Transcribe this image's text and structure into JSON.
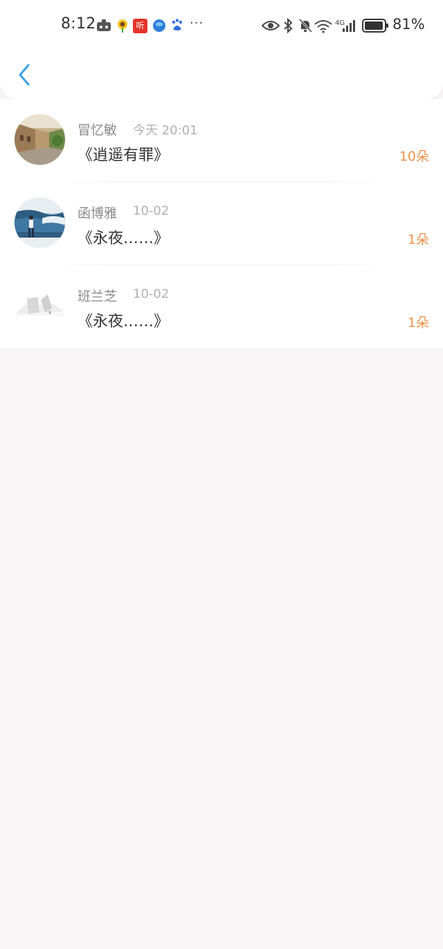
{
  "status_bar": {
    "time": "8:12",
    "ting_app_label": "听",
    "more_notifications": "···",
    "network_type": "4G",
    "battery": "81%"
  },
  "nav": {
    "back_icon": "chevron-left-icon"
  },
  "colors": {
    "accent_blue": "#3aa2e4",
    "count_orange": "#f0914a",
    "background": "#f8f5f6"
  },
  "records": [
    {
      "name": "冒忆敏",
      "time": "今天 20:01",
      "title": "《逍遥有罪》",
      "count": "10朵"
    },
    {
      "name": "函博雅",
      "time": "10-02",
      "title": "《永夜……》",
      "count": "1朵"
    },
    {
      "name": "班兰芝",
      "time": "10-02",
      "title": "《永夜……》",
      "count": "1朵"
    }
  ]
}
